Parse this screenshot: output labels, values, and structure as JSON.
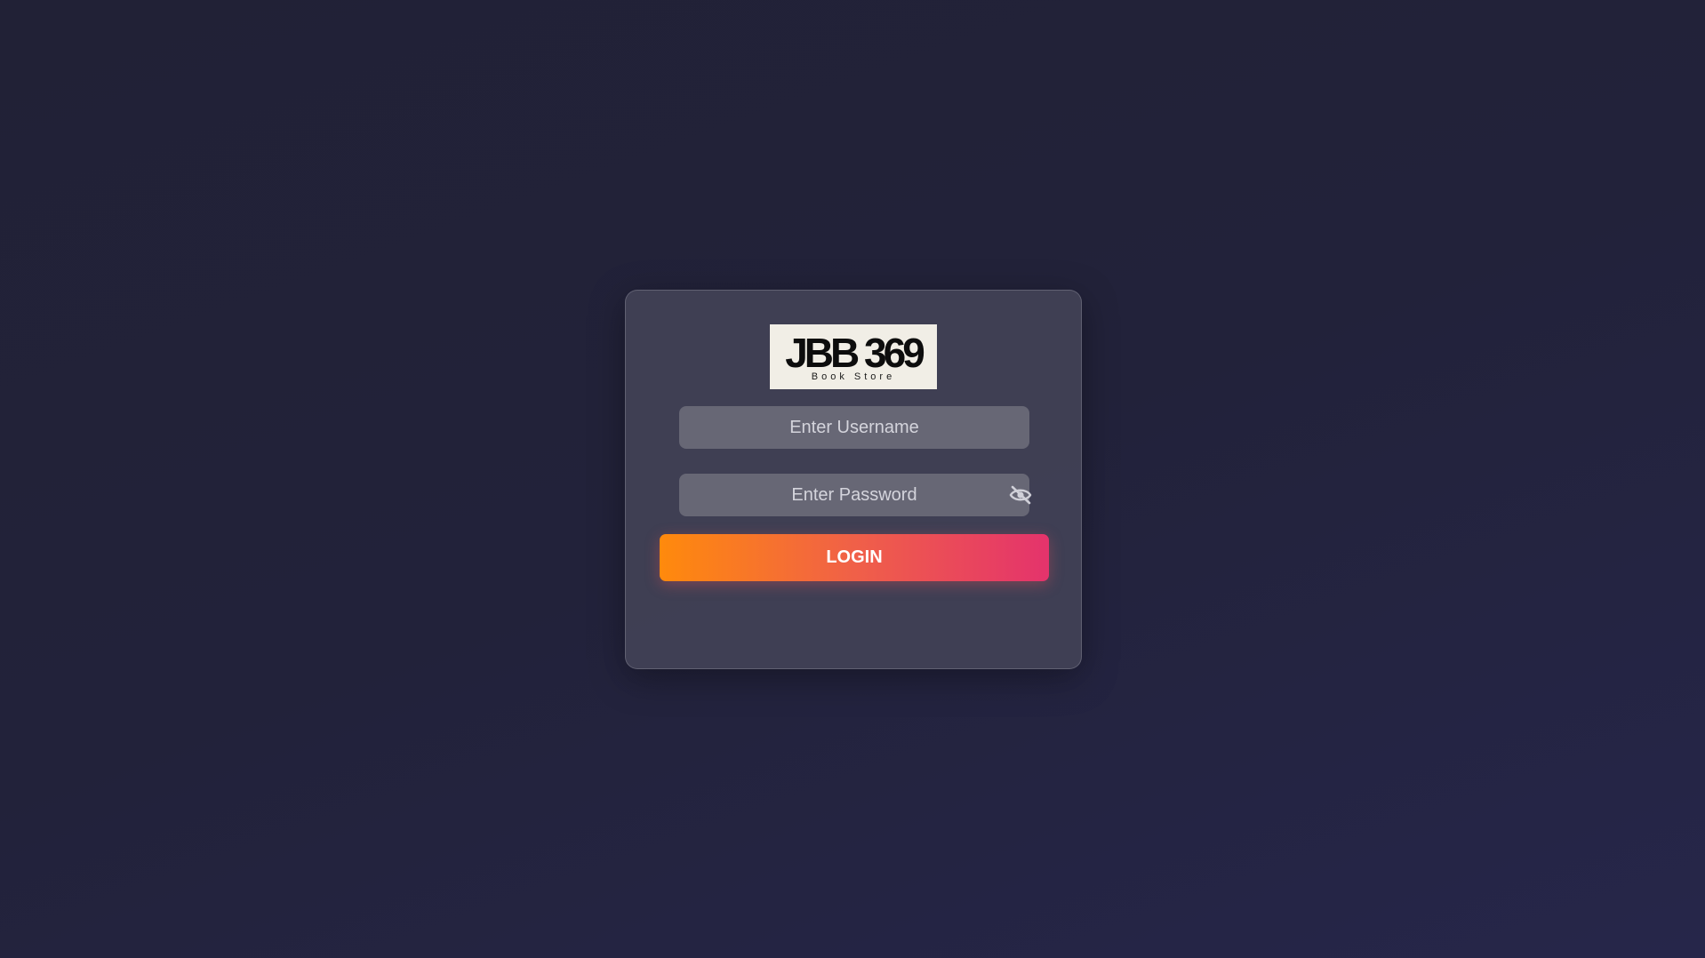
{
  "logo": {
    "main_text": "JBB 369",
    "sub_text": "Book Store"
  },
  "form": {
    "username_placeholder": "Enter Username",
    "password_placeholder": "Enter Password",
    "password_toggle_icon": "eye-slash-icon",
    "login_label": "LOGIN"
  },
  "colors": {
    "background": "#22223a",
    "card": "#444458",
    "input": "#676775",
    "button_gradient_start": "#ff8a0c",
    "button_gradient_end": "#e4336c"
  }
}
